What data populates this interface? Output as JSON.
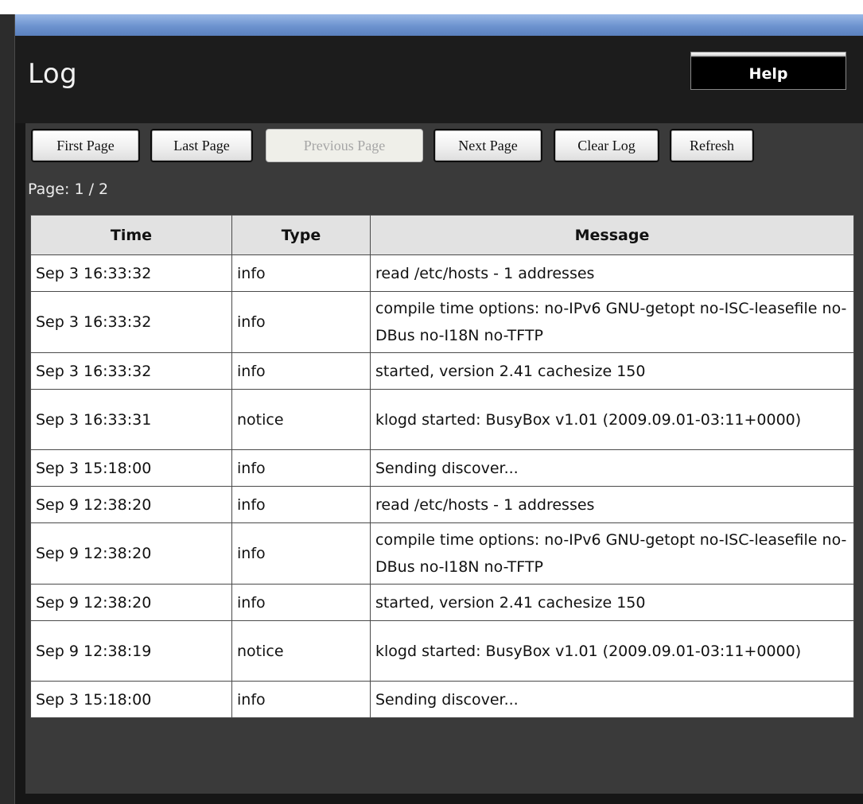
{
  "header": {
    "title": "Log",
    "help_label": "Help"
  },
  "toolbar": {
    "first_page": "First Page",
    "last_page": "Last Page",
    "previous_page": "Previous Page",
    "next_page": "Next Page",
    "clear_log": "Clear Log",
    "refresh": "Refresh"
  },
  "page_info": "Page: 1 / 2",
  "table": {
    "columns": [
      "Time",
      "Type",
      "Message"
    ],
    "rows": [
      {
        "time": "Sep 3 16:33:32",
        "type": "info",
        "message": "read /etc/hosts - 1 addresses"
      },
      {
        "time": "Sep 3 16:33:32",
        "type": "info",
        "message": "compile time options: no-IPv6 GNU-getopt no-ISC-leasefile no-DBus no-I18N no-TFTP"
      },
      {
        "time": "Sep 3 16:33:32",
        "type": "info",
        "message": "started, version 2.41 cachesize 150"
      },
      {
        "time": "Sep 3 16:33:31",
        "type": "notice",
        "message": "klogd started: BusyBox v1.01 (2009.09.01-03:11+0000)"
      },
      {
        "time": "Sep 3 15:18:00",
        "type": "info",
        "message": "Sending discover..."
      },
      {
        "time": "Sep 9 12:38:20",
        "type": "info",
        "message": "read /etc/hosts - 1 addresses"
      },
      {
        "time": "Sep 9 12:38:20",
        "type": "info",
        "message": "compile time options: no-IPv6 GNU-getopt no-ISC-leasefile no-DBus no-I18N no-TFTP"
      },
      {
        "time": "Sep 9 12:38:20",
        "type": "info",
        "message": "started, version 2.41 cachesize 150"
      },
      {
        "time": "Sep 9 12:38:19",
        "type": "notice",
        "message": "klogd started: BusyBox v1.01 (2009.09.01-03:11+0000)"
      },
      {
        "time": "Sep 3 15:18:00",
        "type": "info",
        "message": "Sending discover..."
      }
    ]
  }
}
